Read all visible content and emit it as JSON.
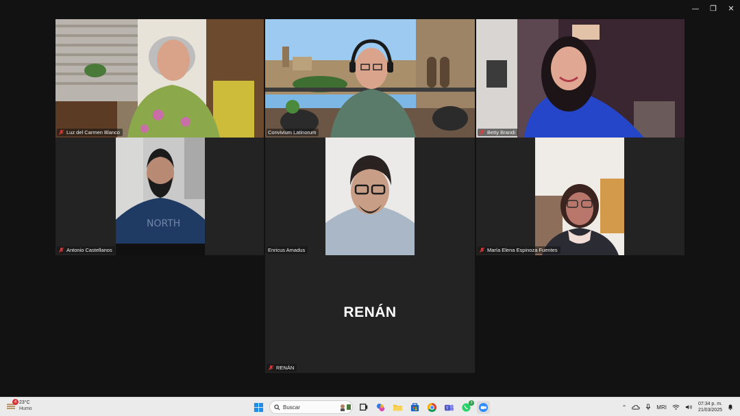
{
  "window": {
    "controls": [
      "—",
      "❐",
      "✕"
    ]
  },
  "participants": [
    {
      "id": "luz",
      "name": "Luz del Carmen Blanco"
    },
    {
      "id": "convivium",
      "name": "Convivium Latinorum",
      "active": true
    },
    {
      "id": "betty",
      "name": "Betty Brandi"
    },
    {
      "id": "antonio",
      "name": "Antonio Castellanos"
    },
    {
      "id": "enricus",
      "name": "Enricus Amadus"
    },
    {
      "id": "maria",
      "name": "María Elena Espinoza Fuentes"
    },
    {
      "id": "renan",
      "name": "RENÁN",
      "display_name": "RENÁN",
      "video_off": true
    }
  ],
  "taskbar": {
    "weather": {
      "temp": "23°C",
      "condition": "Humo",
      "badge": "4"
    },
    "search_placeholder": "Buscar",
    "whatsapp_badge": "3",
    "tray": {
      "mic_label": "MRI"
    },
    "clock": {
      "time": "07:34 p. m.",
      "date": "21/03/2025"
    }
  },
  "colors": {
    "active_speaker": "#2fd06b",
    "tile_bg": "#232323",
    "page_bg": "#121212",
    "taskbar_bg": "#ecebeb"
  }
}
